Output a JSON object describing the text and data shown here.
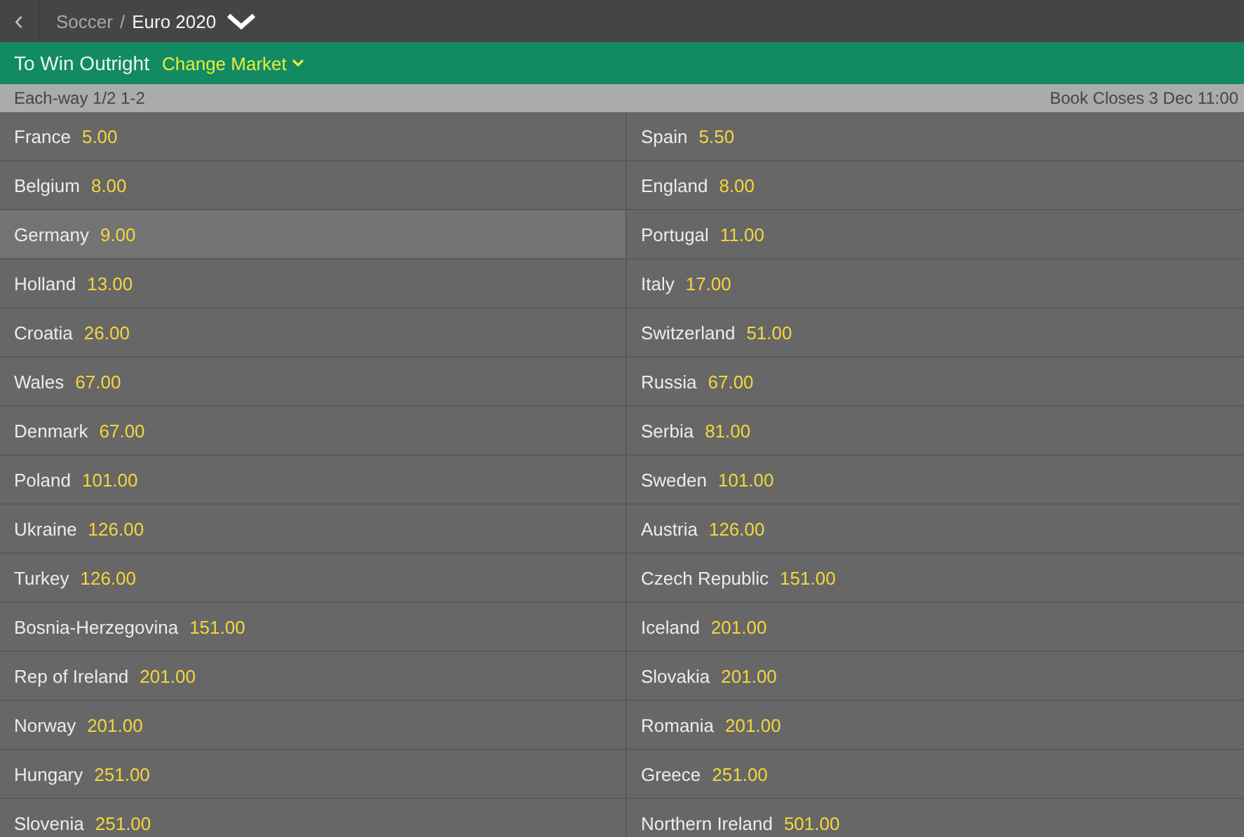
{
  "breadcrumb": {
    "back": "‹",
    "parent": "Soccer",
    "separator": "/",
    "current": "Euro 2020"
  },
  "market": {
    "title": "To Win Outright",
    "change": "Change Market"
  },
  "info": {
    "each_way": "Each-way 1/2 1-2",
    "closes": "Book Closes 3 Dec 11:00"
  },
  "selections": [
    {
      "name": "France",
      "odds": "5.00",
      "selected": false
    },
    {
      "name": "Spain",
      "odds": "5.50",
      "selected": false
    },
    {
      "name": "Belgium",
      "odds": "8.00",
      "selected": false
    },
    {
      "name": "England",
      "odds": "8.00",
      "selected": false
    },
    {
      "name": "Germany",
      "odds": "9.00",
      "selected": true
    },
    {
      "name": "Portugal",
      "odds": "11.00",
      "selected": false
    },
    {
      "name": "Holland",
      "odds": "13.00",
      "selected": false
    },
    {
      "name": "Italy",
      "odds": "17.00",
      "selected": false
    },
    {
      "name": "Croatia",
      "odds": "26.00",
      "selected": false
    },
    {
      "name": "Switzerland",
      "odds": "51.00",
      "selected": false
    },
    {
      "name": "Wales",
      "odds": "67.00",
      "selected": false
    },
    {
      "name": "Russia",
      "odds": "67.00",
      "selected": false
    },
    {
      "name": "Denmark",
      "odds": "67.00",
      "selected": false
    },
    {
      "name": "Serbia",
      "odds": "81.00",
      "selected": false
    },
    {
      "name": "Poland",
      "odds": "101.00",
      "selected": false
    },
    {
      "name": "Sweden",
      "odds": "101.00",
      "selected": false
    },
    {
      "name": "Ukraine",
      "odds": "126.00",
      "selected": false
    },
    {
      "name": "Austria",
      "odds": "126.00",
      "selected": false
    },
    {
      "name": "Turkey",
      "odds": "126.00",
      "selected": false
    },
    {
      "name": "Czech Republic",
      "odds": "151.00",
      "selected": false
    },
    {
      "name": "Bosnia-Herzegovina",
      "odds": "151.00",
      "selected": false
    },
    {
      "name": "Iceland",
      "odds": "201.00",
      "selected": false
    },
    {
      "name": "Rep of Ireland",
      "odds": "201.00",
      "selected": false
    },
    {
      "name": "Slovakia",
      "odds": "201.00",
      "selected": false
    },
    {
      "name": "Norway",
      "odds": "201.00",
      "selected": false
    },
    {
      "name": "Romania",
      "odds": "201.00",
      "selected": false
    },
    {
      "name": "Hungary",
      "odds": "251.00",
      "selected": false
    },
    {
      "name": "Greece",
      "odds": "251.00",
      "selected": false
    },
    {
      "name": "Slovenia",
      "odds": "251.00",
      "selected": false
    },
    {
      "name": "Northern Ireland",
      "odds": "501.00",
      "selected": false
    }
  ]
}
